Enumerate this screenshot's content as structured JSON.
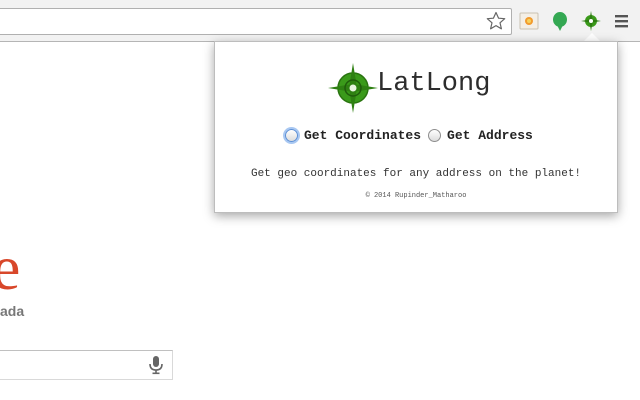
{
  "browser": {
    "star_icon": "star-outline-icon",
    "extensions": [
      {
        "name": "photo-extension-icon"
      },
      {
        "name": "green-pin-extension-icon"
      },
      {
        "name": "latlong-extension-icon"
      }
    ],
    "menu_icon": "hamburger-menu-icon"
  },
  "page": {
    "logo_letter": "e",
    "logo_subtext": "ada",
    "mic_icon": "microphone-icon"
  },
  "popup": {
    "app_title": "LatLong",
    "options": [
      {
        "label": "Get Coordinates",
        "selected": false,
        "focused": true
      },
      {
        "label": "Get Address",
        "selected": false,
        "focused": false
      }
    ],
    "tagline": "Get geo coordinates for any address on the planet!",
    "copyright": "© 2014 Rupinder_Matharoo"
  },
  "colors": {
    "accent_green": "#3a9a1a",
    "logo_red": "#d8472a"
  }
}
